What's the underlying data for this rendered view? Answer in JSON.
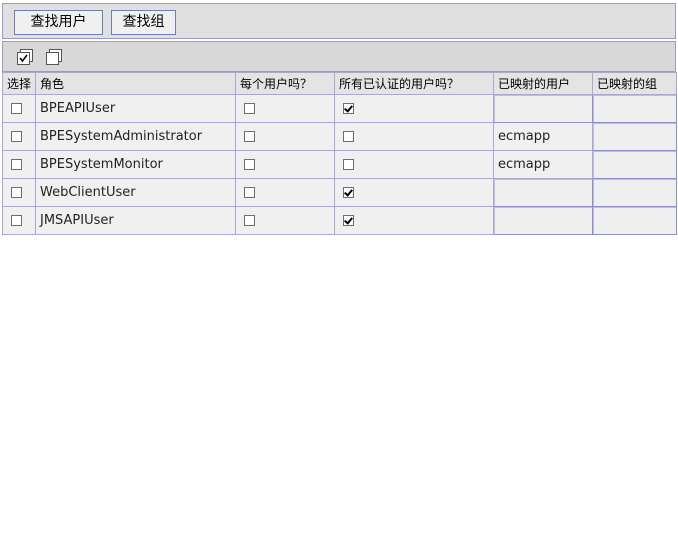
{
  "toolbar": {
    "find_users_label": "查找用户",
    "find_groups_label": "查找组"
  },
  "icons": {
    "select_all": "select-all-icon",
    "deselect_all": "deselect-all-icon"
  },
  "table": {
    "headers": {
      "select": "选择",
      "role": "角色",
      "everyone": "每个用户吗？",
      "all_authenticated": "所有已认证的用户吗？",
      "mapped_users": "已映射的用户",
      "mapped_groups": "已映射的组"
    },
    "rows": [
      {
        "role": "BPEAPIUser",
        "selected": false,
        "everyone": false,
        "all_authenticated": true,
        "mapped_users": "",
        "mapped_groups": ""
      },
      {
        "role": "BPESystemAdministrator",
        "selected": false,
        "everyone": false,
        "all_authenticated": false,
        "mapped_users": "ecmapp",
        "mapped_groups": ""
      },
      {
        "role": "BPESystemMonitor",
        "selected": false,
        "everyone": false,
        "all_authenticated": false,
        "mapped_users": "ecmapp",
        "mapped_groups": ""
      },
      {
        "role": "WebClientUser",
        "selected": false,
        "everyone": false,
        "all_authenticated": true,
        "mapped_users": "",
        "mapped_groups": ""
      },
      {
        "role": "JMSAPIUser",
        "selected": false,
        "everyone": false,
        "all_authenticated": true,
        "mapped_users": "",
        "mapped_groups": ""
      }
    ]
  },
  "colors": {
    "border": "#a9a9cf",
    "header_bg": "#e4e4e4",
    "row_bg": "#f0f0f0",
    "toolbar_bg": "#e0e0e0"
  }
}
